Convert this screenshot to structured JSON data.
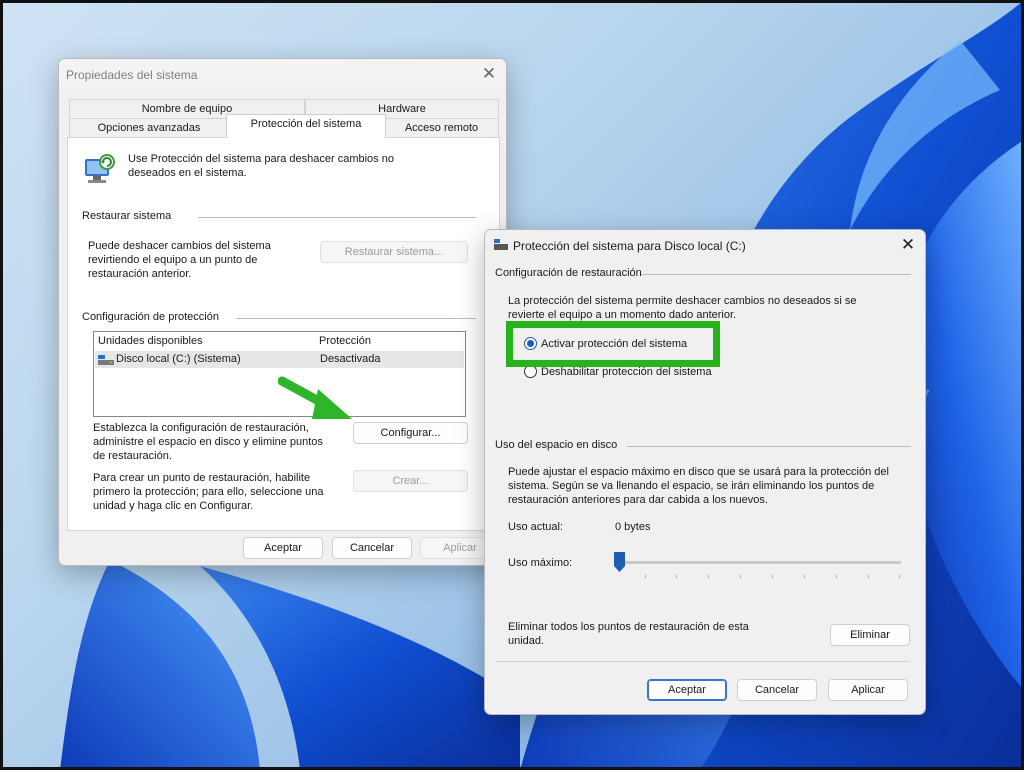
{
  "system_properties": {
    "title": "Propiedades del sistema",
    "tabs": [
      "Nombre de equipo",
      "Hardware",
      "Opciones avanzadas",
      "Protección del sistema",
      "Acceso remoto"
    ],
    "intro": [
      "Use Protección del sistema para deshacer cambios no",
      "deseados en el sistema."
    ],
    "restore_header": "Restaurar sistema",
    "restore_desc": [
      "Puede deshacer cambios del sistema",
      "revirtiendo el equipo a un punto de",
      "restauración anterior."
    ],
    "restore_button": "Restaurar sistema...",
    "protection_header": "Configuración de protección",
    "list_headers": [
      "Unidades disponibles",
      "Protección"
    ],
    "drive_name": "Disco local (C:) (Sistema)",
    "drive_status": "Desactivada",
    "configure_desc": [
      "Establezca la configuración de restauración,",
      "administre el espacio en disco y elimine puntos",
      "de restauración."
    ],
    "configure_button": "Configurar...",
    "create_desc": [
      "Para crear un punto de restauración, habilite",
      "primero la protección; para ello, seleccione una",
      "unidad y haga clic en Configurar."
    ],
    "create_button": "Crear...",
    "ok": "Aceptar",
    "cancel": "Cancelar",
    "apply": "Aplicar"
  },
  "protection_dialog": {
    "title": "Protección del sistema para Disco local (C:)",
    "restore_settings_header": "Configuración de restauración",
    "restore_settings_desc": [
      "La protección del sistema permite deshacer cambios no deseados si se",
      "revierte el equipo a un momento dado anterior."
    ],
    "option_enable": "Activar protección del sistema",
    "option_disable": "Deshabilitar protección del sistema",
    "disk_usage_header": "Uso del espacio en disco",
    "disk_usage_desc": [
      "Puede ajustar el espacio máximo en disco que se usará para la protección del",
      "sistema. Según se va llenando el espacio, se irán eliminando los puntos de",
      "restauración anteriores para dar cabida a los nuevos."
    ],
    "current_usage_label": "Uso actual:",
    "current_usage_value": "0 bytes",
    "max_usage_label": "Uso máximo:",
    "max_usage_level": 0.0,
    "delete_desc": [
      "Eliminar todos los puntos de restauración de esta",
      "unidad."
    ],
    "delete_button": "Eliminar",
    "ok": "Aceptar",
    "cancel": "Cancelar",
    "apply": "Aplicar"
  },
  "colors": {
    "accent": "#1a5fb4",
    "highlight": "#26b31e",
    "arrow": "#2fb52a"
  }
}
